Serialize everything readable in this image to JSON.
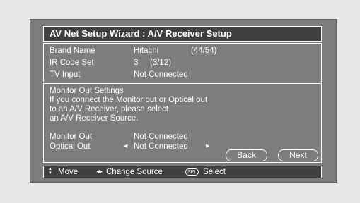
{
  "title": "AV Net Setup Wizard : A/V Receiver Setup",
  "info": {
    "brand_label": "Brand Name",
    "brand_value": "Hitachi",
    "brand_count": "(44/54)",
    "ir_label": "IR Code Set",
    "ir_value": "3",
    "ir_count": "(3/12)",
    "tv_label": "TV Input",
    "tv_value": "Not Connected"
  },
  "monitor_settings": {
    "heading": "Monitor Out Settings",
    "line1": "If you connect the Monitor out or Optical out",
    "line2": "to an A/V Receiver, please select",
    "line3": "an A/V Receiver Source.",
    "monitor_out_label": "Monitor Out",
    "monitor_out_value": "Not Connected",
    "optical_out_label": "Optical Out",
    "optical_out_value": "Not Connected"
  },
  "buttons": {
    "back": "Back",
    "next": "Next"
  },
  "help": {
    "move": "Move",
    "change_source": "Change Source",
    "sel_badge": "SEL",
    "select": "Select"
  },
  "colors": {
    "background": "#e6e6e6",
    "panel": "#7d7d7d",
    "bar": "#3f3f3f",
    "text": "#ffffff"
  }
}
